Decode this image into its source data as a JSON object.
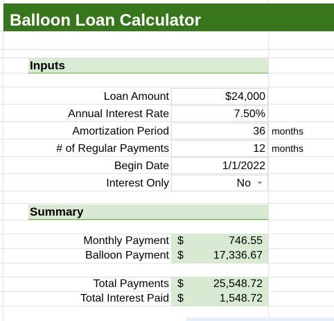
{
  "title": "Balloon Loan Calculator",
  "sections": {
    "inputs_header": "Inputs",
    "summary_header": "Summary"
  },
  "inputs": [
    {
      "label": "Loan Amount",
      "value": "$24,000",
      "unit": ""
    },
    {
      "label": "Annual Interest Rate",
      "value": "7.50%",
      "unit": ""
    },
    {
      "label": "Amortization Period",
      "value": "36",
      "unit": "months"
    },
    {
      "label": "# of Regular Payments",
      "value": "12",
      "unit": "months"
    },
    {
      "label": "Begin Date",
      "value": "1/1/2022",
      "unit": ""
    },
    {
      "label": "Interest Only",
      "value": "No",
      "unit": ""
    }
  ],
  "summary": [
    {
      "label": "Monthly Payment",
      "currency": "$",
      "value": "746.55"
    },
    {
      "label": "Balloon Payment",
      "currency": "$",
      "value": "17,336.67"
    },
    {
      "label": "Total Payments",
      "currency": "$",
      "value": "25,548.72"
    },
    {
      "label": "Total Interest Paid",
      "currency": "$",
      "value": "1,548.72"
    }
  ],
  "colors": {
    "title_bg": "#38761d",
    "header_bg": "#d9ead3",
    "header_border": "#6aa84f",
    "grid": "#e2e3e3"
  }
}
